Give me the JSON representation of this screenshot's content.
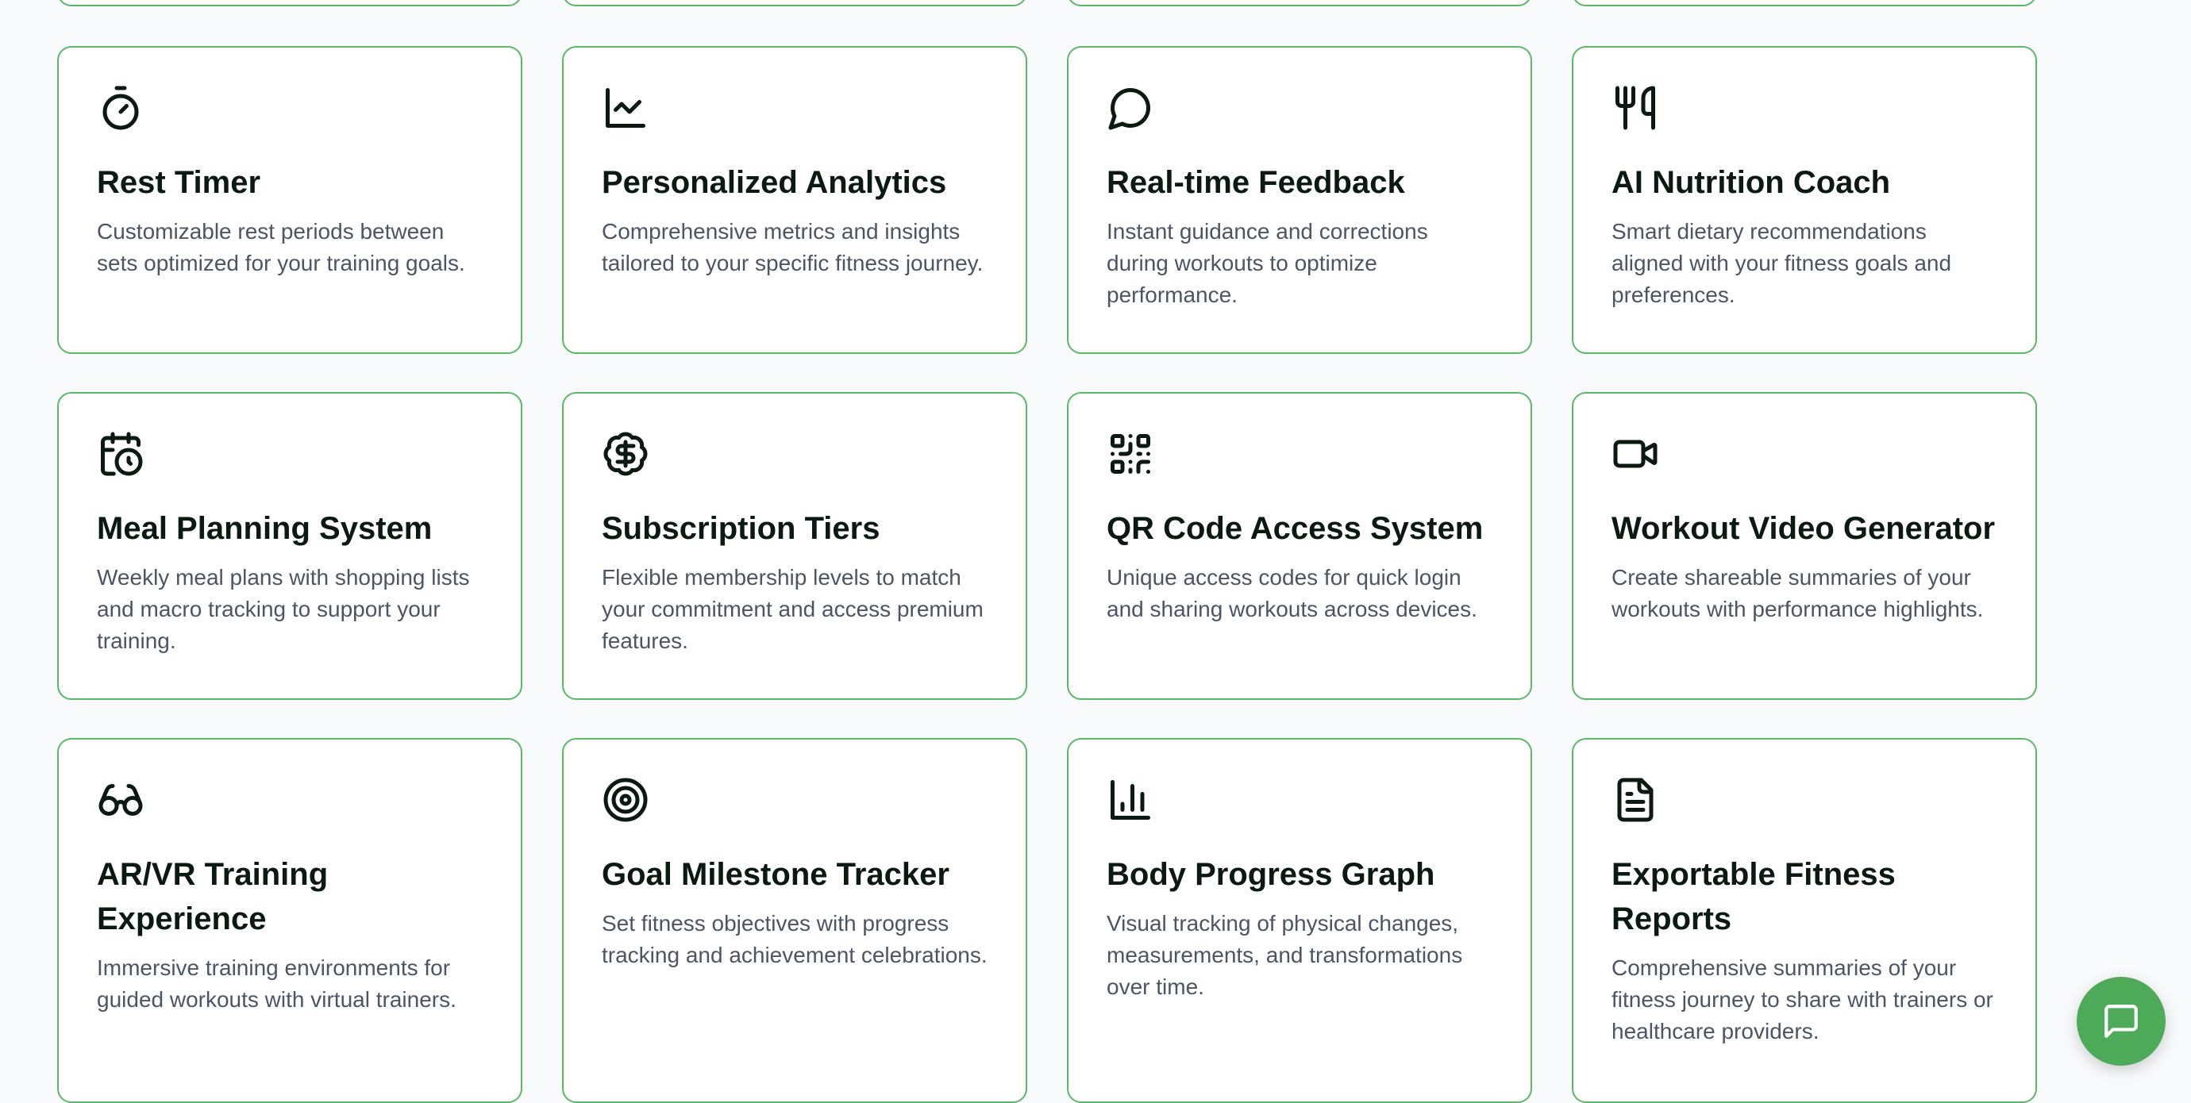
{
  "features": [
    {
      "title": "Rest Timer",
      "description": "Customizable rest periods between sets optimized for your training goals.",
      "icon": "stopwatch-icon"
    },
    {
      "title": "Personalized Analytics",
      "description": "Comprehensive metrics and insights tailored to your specific fitness journey.",
      "icon": "line-chart-icon"
    },
    {
      "title": "Real-time Feedback",
      "description": "Instant guidance and corrections during workouts to optimize performance.",
      "icon": "speech-bubble-icon"
    },
    {
      "title": "AI Nutrition Coach",
      "description": "Smart dietary recommendations aligned with your fitness goals and preferences.",
      "icon": "utensils-icon"
    },
    {
      "title": "Meal Planning System",
      "description": "Weekly meal plans with shopping lists and macro tracking to support your training.",
      "icon": "calendar-clock-icon"
    },
    {
      "title": "Subscription Tiers",
      "description": "Flexible membership levels to match your commitment and access premium features.",
      "icon": "dollar-badge-icon"
    },
    {
      "title": "QR Code Access System",
      "description": "Unique access codes for quick login and sharing workouts across devices.",
      "icon": "qr-code-icon"
    },
    {
      "title": "Workout Video Generator",
      "description": "Create shareable summaries of your workouts with performance highlights.",
      "icon": "video-camera-icon"
    },
    {
      "title": "AR/VR Training Experience",
      "description": "Immersive training environments for guided workouts with virtual trainers.",
      "icon": "glasses-icon"
    },
    {
      "title": "Goal Milestone Tracker",
      "description": "Set fitness objectives with progress tracking and achievement celebrations.",
      "icon": "target-icon"
    },
    {
      "title": "Body Progress Graph",
      "description": "Visual tracking of physical changes, measurements, and transformations over time.",
      "icon": "bar-chart-icon"
    },
    {
      "title": "Exportable Fitness Reports",
      "description": "Comprehensive summaries of your fitness journey to share with trainers or healthcare providers.",
      "icon": "document-icon"
    }
  ],
  "chat": {
    "icon": "chat-icon"
  },
  "colors": {
    "card_border": "#5cb868",
    "chat_button": "#4caa58",
    "title_text": "#0b1a10",
    "body_text": "#4b5563",
    "background": "#f8fafc"
  }
}
